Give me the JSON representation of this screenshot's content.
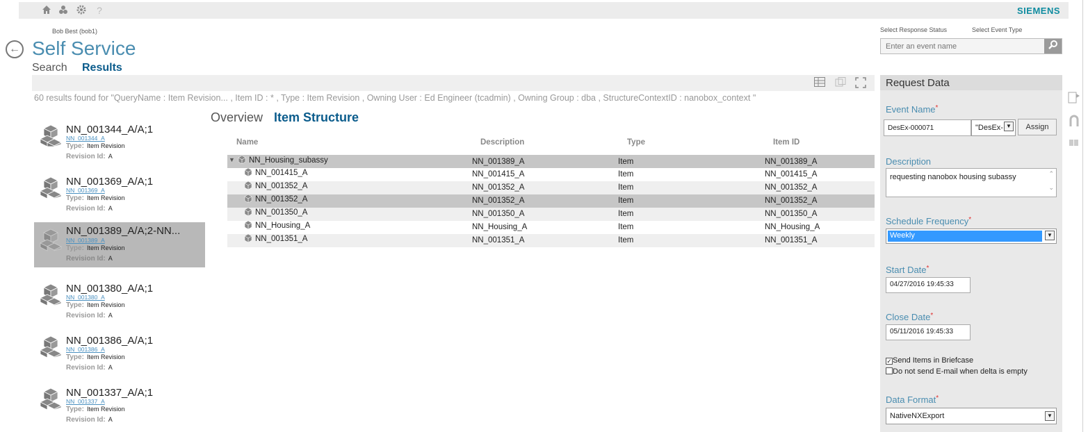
{
  "topbar": {
    "icons": [
      "home-icon",
      "org-icon",
      "gear-icon",
      "help-icon"
    ],
    "help_glyph": "?",
    "brand": "SIEMENS"
  },
  "header": {
    "user": "Bob Best (bob1)",
    "title": "Self Service",
    "crumbs": {
      "search": "Search",
      "results": "Results"
    },
    "select_response_status": "Select Response Status",
    "select_event_type": "Select Event Type",
    "event_search_placeholder": "Enter an event name"
  },
  "results": {
    "summary": "60 results found for \"QueryName : Item Revision... , Item ID : * , Type : Item Revision , Owning User : Ed Engineer (tcadmin) , Owning Group : dba , StructureContextID : nanobox_context \"",
    "type_label": "Type:",
    "revision_label": "Revision Id:",
    "items": [
      {
        "title": "NN_001344_A/A;1",
        "id": "NN_001344_A",
        "type": "Item Revision",
        "revision": "A"
      },
      {
        "title": "NN_001369_A/A;1",
        "id": "NN_001369_A",
        "type": "Item Revision",
        "revision": "A"
      },
      {
        "title": "NN_001389_A/A;2-NN...",
        "id": "NN_001389_A",
        "type": "Item Revision",
        "revision": "A"
      },
      {
        "title": "NN_001380_A/A;1",
        "id": "NN_001380_A",
        "type": "Item Revision",
        "revision": "A"
      },
      {
        "title": "NN_001386_A/A;1",
        "id": "NN_001386_A",
        "type": "Item Revision",
        "revision": "A"
      },
      {
        "title": "NN_001337_A/A;1",
        "id": "NN_001337_A",
        "type": "Item Revision",
        "revision": "A"
      }
    ]
  },
  "tabs": {
    "overview": "Overview",
    "structure": "Item Structure"
  },
  "structure_table": {
    "headers": {
      "name": "Name",
      "description": "Description",
      "type": "Type",
      "item_id": "Item ID"
    },
    "rows": [
      {
        "name": "NN_Housing_subassy",
        "description": "NN_001389_A",
        "type": "Item",
        "item_id": "NN_001389_A"
      },
      {
        "name": "NN_001415_A",
        "description": "NN_001415_A",
        "type": "Item",
        "item_id": "NN_001415_A"
      },
      {
        "name": "NN_001352_A",
        "description": "NN_001352_A",
        "type": "Item",
        "item_id": "NN_001352_A"
      },
      {
        "name": "NN_001352_A",
        "description": "NN_001352_A",
        "type": "Item",
        "item_id": "NN_001352_A"
      },
      {
        "name": "NN_001350_A",
        "description": "NN_001350_A",
        "type": "Item",
        "item_id": "NN_001350_A"
      },
      {
        "name": "NN_Housing_A",
        "description": "NN_Housing_A",
        "type": "Item",
        "item_id": "NN_Housing_A"
      },
      {
        "name": "NN_001351_A",
        "description": "NN_001351_A",
        "type": "Item",
        "item_id": "NN_001351_A"
      }
    ]
  },
  "request_panel": {
    "title": "Request Data",
    "event_name_label": "Event Name",
    "event_name_value": "DesEx-000071",
    "event_type_value": "\"DesEx-",
    "assign_label": "Assign",
    "description_label": "Description",
    "description_value": "requesting nanobox housing subassy",
    "schedule_label": "Schedule Frequency",
    "schedule_value": "Weekly",
    "start_label": "Start Date",
    "start_value": "04/27/2016 19:45:33",
    "close_label": "Close Date",
    "close_value": "05/11/2016 19:45:33",
    "send_briefcase": {
      "label": "Send Items in Briefcase",
      "checked": true
    },
    "no_email": {
      "label": "Do not send E-mail when delta is empty",
      "checked": false
    },
    "data_format_label": "Data Format",
    "data_format_value": "NativeNXExport",
    "required_mark": "*"
  },
  "colors": {
    "accent": "#4a8db0",
    "title_dark": "#0b5c8c",
    "brand": "#0f8ca0",
    "selection": "#3399ff"
  }
}
